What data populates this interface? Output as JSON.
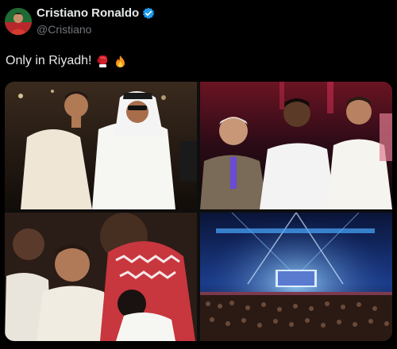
{
  "author": {
    "display_name": "Cristiano Ronaldo",
    "handle": "@Cristiano",
    "verified": true,
    "avatar_icon": "profile-photo-avatar",
    "verified_icon": "verified-badge-icon"
  },
  "tweet": {
    "text": "Only in Riyadh!",
    "emojis": [
      "boxing-glove-icon",
      "fire-icon"
    ]
  },
  "media": {
    "photos": [
      {
        "icon": "photo-ringside-two-men"
      },
      {
        "icon": "photo-ringside-four-men"
      },
      {
        "icon": "photo-ringside-closeup"
      },
      {
        "icon": "photo-arena-overview"
      }
    ]
  },
  "colors": {
    "background": "#000000",
    "text": "#e7e9ea",
    "secondary_text": "#71767b",
    "verified_blue": "#1d9bf0",
    "glove_red": "#d0202a",
    "fire_orange": "#f7931e"
  }
}
